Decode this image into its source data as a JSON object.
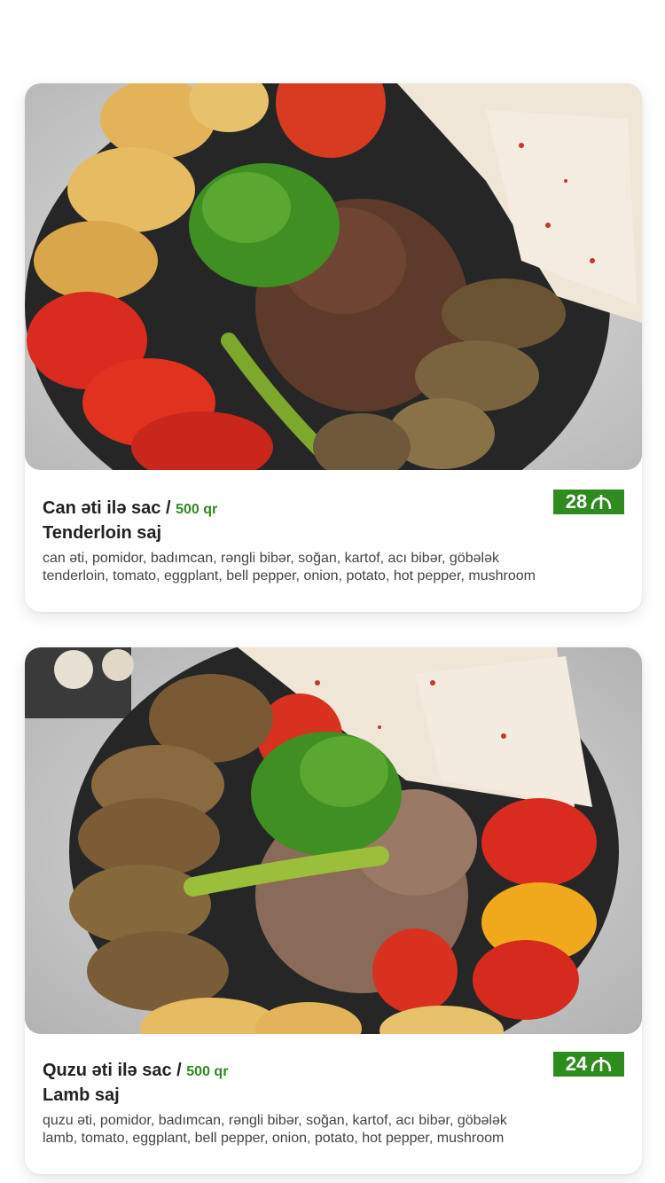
{
  "menu_items": [
    {
      "title_az": "Can əti ilə sac / ",
      "weight": "500 qr",
      "title_en": "Tenderloin saj",
      "price": "28",
      "currency_icon": "manat-icon",
      "desc_az": "can əti, pomidor, badımcan, rəngli bibər, soğan, kartof, acı bibər, göbələk",
      "desc_en": "tenderloin, tomato, eggplant, bell pepper, onion, potato, hot pepper, mushroom"
    },
    {
      "title_az": "Quzu əti ilə sac / ",
      "weight": "500 qr",
      "title_en": "Lamb saj",
      "price": "24",
      "currency_icon": "manat-icon",
      "desc_az": "quzu əti, pomidor, badımcan, rəngli bibər, soğan, kartof, acı bibər, göbələk",
      "desc_en": "lamb, tomato, eggplant, bell pepper, onion, potato, hot pepper, mushroom"
    }
  ],
  "colors": {
    "accent_green": "#2e8b1e",
    "text_dark": "#222222",
    "text_muted": "#444444"
  }
}
